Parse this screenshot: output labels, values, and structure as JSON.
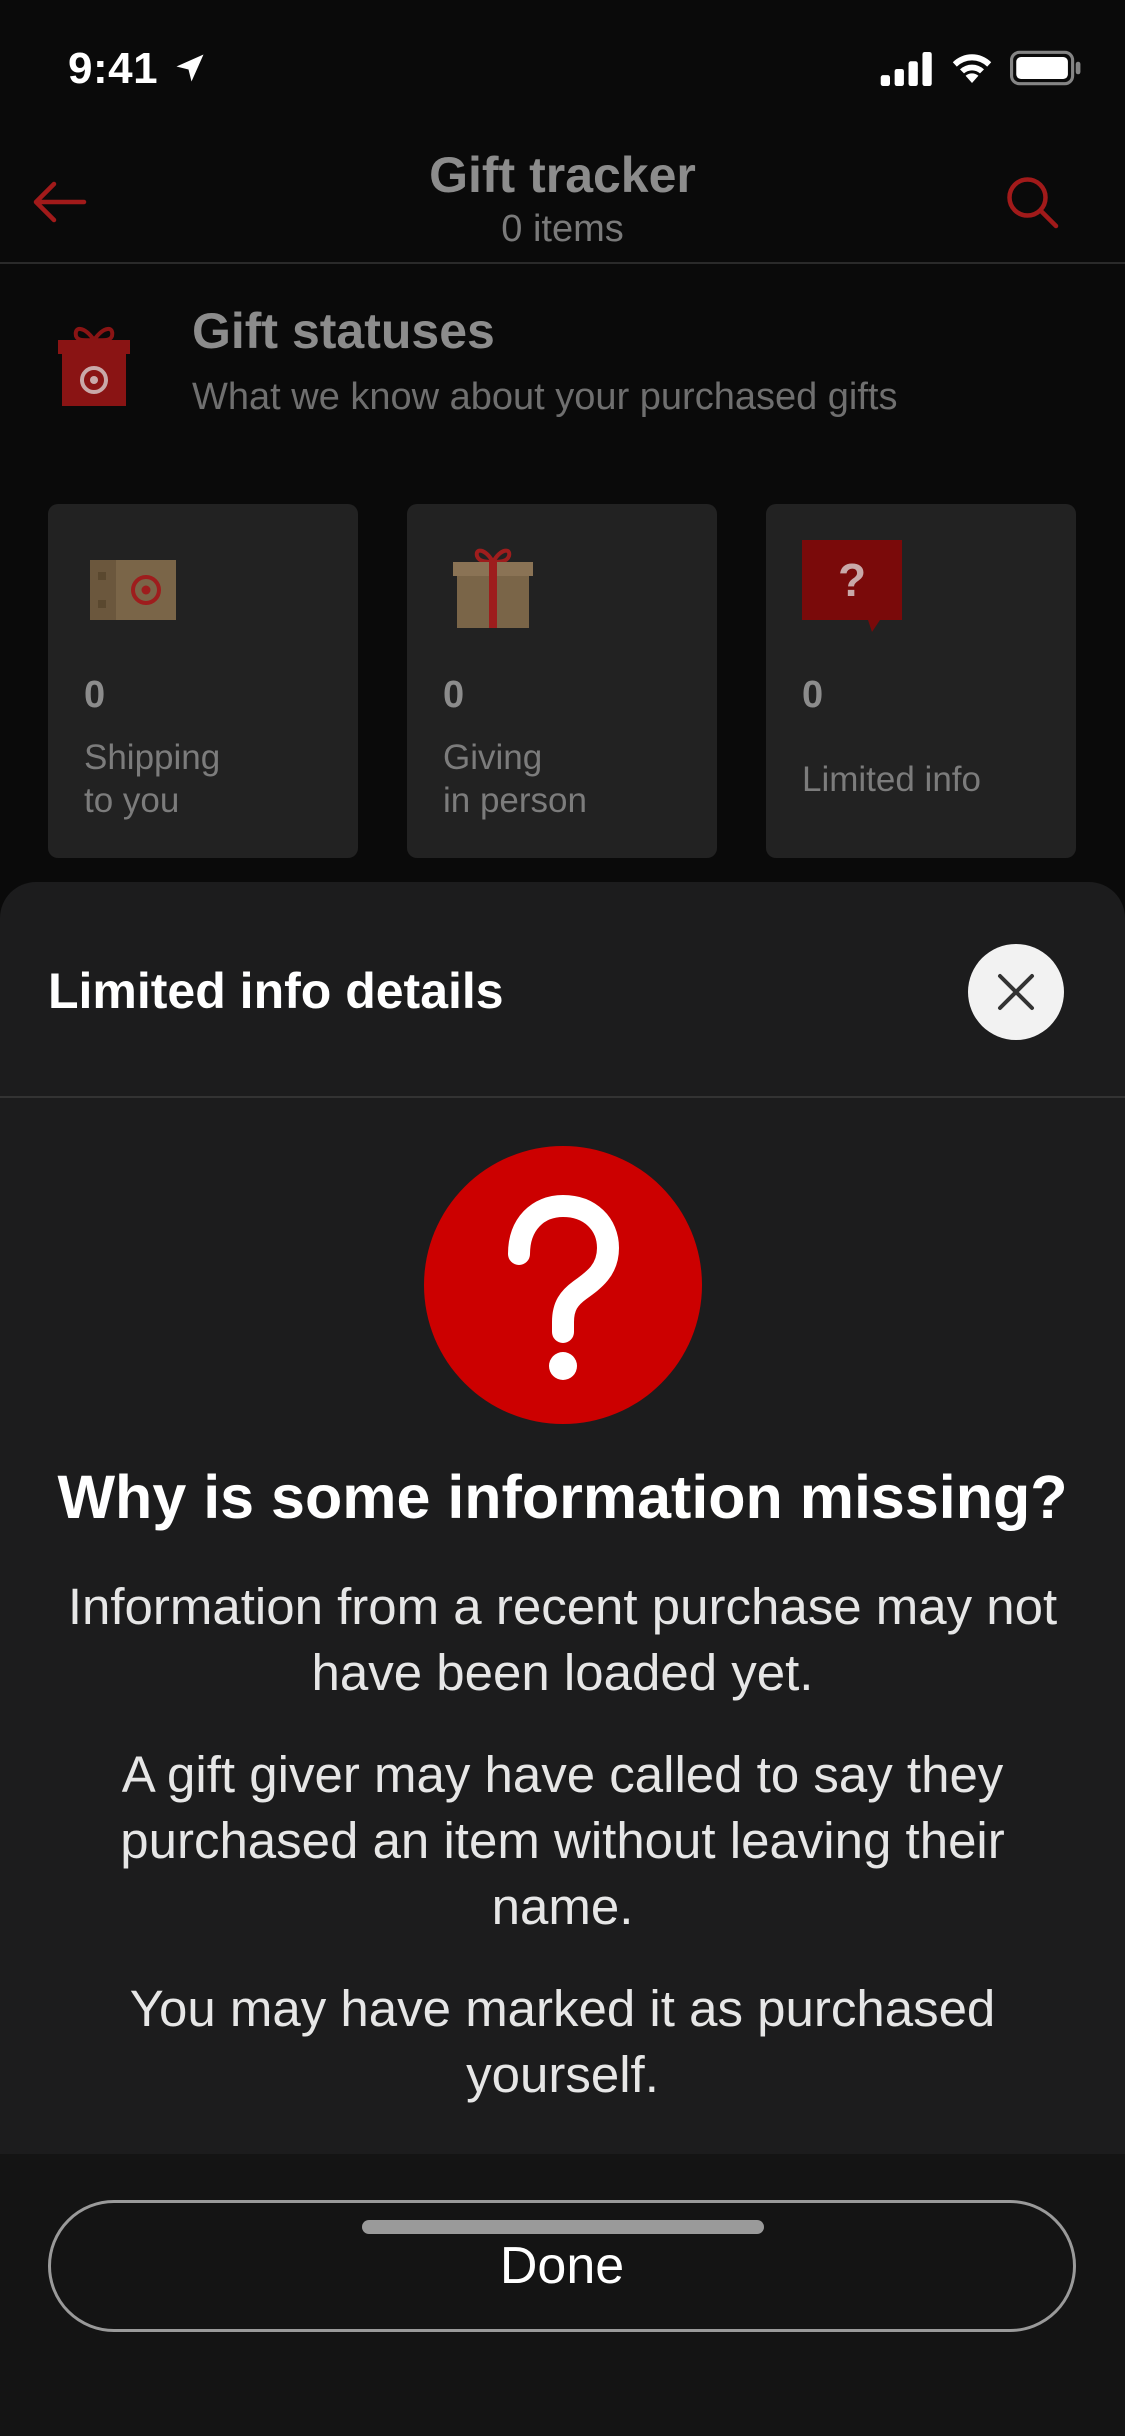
{
  "status_bar": {
    "time": "9:41"
  },
  "header": {
    "title": "Gift tracker",
    "subtitle": "0 items"
  },
  "statuses": {
    "title": "Gift statuses",
    "subtitle": "What we know about your purchased gifts",
    "cards": [
      {
        "count": "0",
        "label": "Shipping\nto you",
        "icon": "shipping-box-icon"
      },
      {
        "count": "0",
        "label": "Giving\nin person",
        "icon": "gift-box-icon"
      },
      {
        "count": "0",
        "label": "Limited info",
        "icon": "question-bubble-icon"
      }
    ]
  },
  "sheet": {
    "title": "Limited info details",
    "heading": "Why is some information missing?",
    "paragraphs": [
      "Information from a recent purchase may not have been loaded yet.",
      "A gift giver may have called to say they purchased an item without leaving their name.",
      "You may have marked it as purchased yourself."
    ],
    "done_label": "Done"
  },
  "colors": {
    "accent": "#cc0000",
    "background": "#0a0a0a",
    "sheet": "#1c1c1d",
    "card": "#222222"
  }
}
